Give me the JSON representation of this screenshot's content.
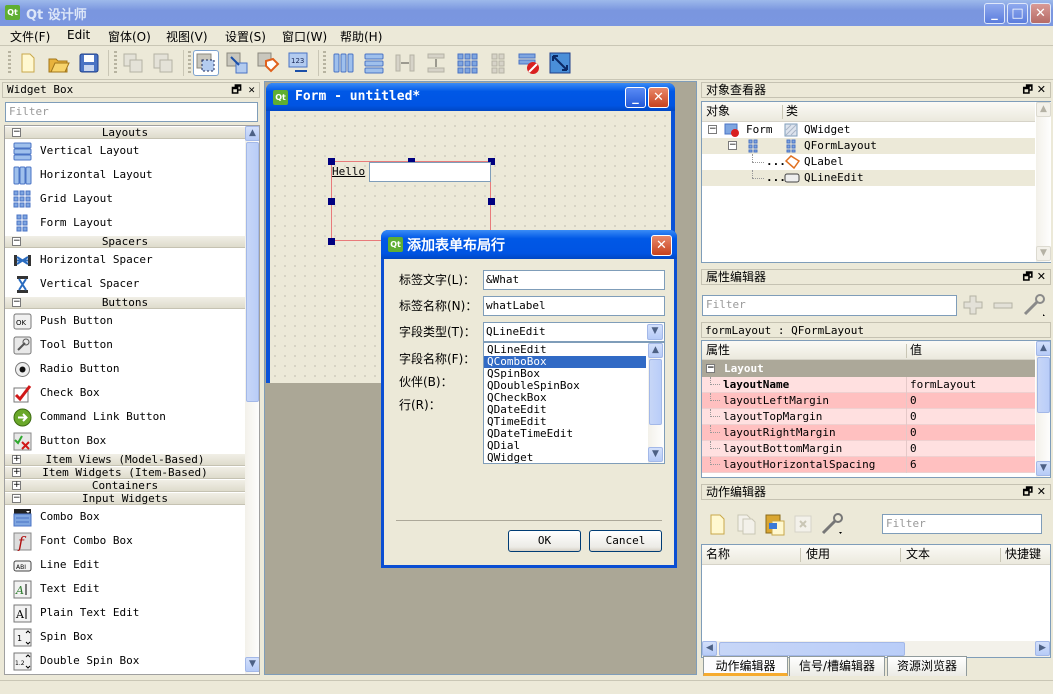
{
  "app": {
    "title": "Qt 设计师",
    "window_buttons": {
      "minimize": "_",
      "maximize": "□",
      "close": "✕"
    }
  },
  "menubar": [
    {
      "label": "文件(F)"
    },
    {
      "label": "Edit"
    },
    {
      "label": "窗体(O)"
    },
    {
      "label": "视图(V)"
    },
    {
      "label": "设置(S)"
    },
    {
      "label": "窗口(W)"
    },
    {
      "label": "帮助(H)"
    }
  ],
  "toolbar": {
    "icons": [
      "new-file-icon",
      "open-folder-icon",
      "save-icon",
      "copy-disabled-icon",
      "paste-disabled-icon",
      "edit-widgets-icon",
      "edit-signals-slots-icon",
      "edit-buddies-icon",
      "edit-tab-order-icon",
      "horizontal-layout-icon",
      "vertical-layout-icon",
      "horizontal-splitter-icon",
      "vertical-splitter-icon",
      "grid-layout-icon",
      "form-layout-icon",
      "break-layout-icon",
      "adjust-size-icon"
    ],
    "active_index": 5
  },
  "widget_box": {
    "title": "Widget Box",
    "filter_placeholder": "Filter",
    "categories": [
      {
        "name": "Layouts",
        "expanded": true,
        "items": [
          {
            "label": "Vertical Layout",
            "icon": "vertical-layout-icon"
          },
          {
            "label": "Horizontal Layout",
            "icon": "horizontal-layout-icon"
          },
          {
            "label": "Grid Layout",
            "icon": "grid-layout-icon"
          },
          {
            "label": "Form Layout",
            "icon": "form-layout-icon"
          }
        ]
      },
      {
        "name": "Spacers",
        "expanded": true,
        "items": [
          {
            "label": "Horizontal Spacer",
            "icon": "horizontal-spacer-icon"
          },
          {
            "label": "Vertical Spacer",
            "icon": "vertical-spacer-icon"
          }
        ]
      },
      {
        "name": "Buttons",
        "expanded": true,
        "items": [
          {
            "label": "Push Button",
            "icon": "push-button-icon"
          },
          {
            "label": "Tool Button",
            "icon": "tool-button-icon"
          },
          {
            "label": "Radio Button",
            "icon": "radio-button-icon"
          },
          {
            "label": "Check Box",
            "icon": "check-box-icon"
          },
          {
            "label": "Command Link Button",
            "icon": "command-link-icon"
          },
          {
            "label": "Button Box",
            "icon": "button-box-icon"
          }
        ]
      },
      {
        "name": "Item Views (Model-Based)",
        "expanded": false,
        "items": []
      },
      {
        "name": "Item Widgets (Item-Based)",
        "expanded": false,
        "items": []
      },
      {
        "name": "Containers",
        "expanded": false,
        "items": []
      },
      {
        "name": "Input Widgets",
        "expanded": true,
        "items": [
          {
            "label": "Combo Box",
            "icon": "combo-box-icon"
          },
          {
            "label": "Font Combo Box",
            "icon": "font-combo-box-icon"
          },
          {
            "label": "Line Edit",
            "icon": "line-edit-icon"
          },
          {
            "label": "Text Edit",
            "icon": "text-edit-icon"
          },
          {
            "label": "Plain Text Edit",
            "icon": "plain-text-edit-icon"
          },
          {
            "label": "Spin Box",
            "icon": "spin-box-icon"
          },
          {
            "label": "Double Spin Box",
            "icon": "double-spin-box-icon"
          }
        ]
      }
    ]
  },
  "form_window": {
    "title": "Form - untitled*",
    "label_text": "Hello",
    "line_edit_value": ""
  },
  "dialog": {
    "title": "添加表单布局行",
    "fields": {
      "label_text": {
        "label": "标签文字(L)：",
        "value": "&What"
      },
      "label_name": {
        "label": "标签名称(N)：",
        "value": "whatLabel"
      },
      "field_type": {
        "label": "字段类型(T)：",
        "value": "QLineEdit"
      },
      "field_name": {
        "label": "字段名称(F)："
      },
      "buddy": {
        "label": "伙伴(B)："
      },
      "row": {
        "label": "行(R)："
      }
    },
    "dropdown_options": [
      "QLineEdit",
      "QComboBox",
      "QSpinBox",
      "QDoubleSpinBox",
      "QCheckBox",
      "QDateEdit",
      "QTimeEdit",
      "QDateTimeEdit",
      "QDial",
      "QWidget"
    ],
    "dropdown_highlighted": "QComboBox",
    "ok_label": "OK",
    "cancel_label": "Cancel"
  },
  "object_inspector": {
    "title": "对象查看器",
    "columns": [
      "对象",
      "类"
    ],
    "rows": [
      {
        "object": "Form",
        "class": "QWidget",
        "level": 0
      },
      {
        "object": "",
        "class": "QFormLayout",
        "level": 1
      },
      {
        "object": "...",
        "class": "QLabel",
        "level": 2
      },
      {
        "object": "...",
        "class": "QLineEdit",
        "level": 2
      }
    ]
  },
  "property_editor": {
    "title": "属性编辑器",
    "filter_placeholder": "Filter",
    "object_label": "formLayout : QFormLayout",
    "columns": [
      "属性",
      "值"
    ],
    "group": "Layout",
    "properties": [
      {
        "name": "layoutName",
        "value": "formLayout",
        "bold": true
      },
      {
        "name": "layoutLeftMargin",
        "value": "0"
      },
      {
        "name": "layoutTopMargin",
        "value": "0"
      },
      {
        "name": "layoutRightMargin",
        "value": "0"
      },
      {
        "name": "layoutBottomMargin",
        "value": "0"
      },
      {
        "name": "layoutHorizontalSpacing",
        "value": "6"
      }
    ]
  },
  "action_editor": {
    "title": "动作编辑器",
    "filter_placeholder": "Filter",
    "columns": [
      "名称",
      "使用",
      "文本",
      "快捷键"
    ],
    "tabs": [
      {
        "label": "动作编辑器",
        "active": true
      },
      {
        "label": "信号/槽编辑器",
        "active": false
      },
      {
        "label": "资源浏览器",
        "active": false
      }
    ]
  },
  "colors": {
    "xp_blue": "#0054e3",
    "selection": "#316ac5",
    "prop_row_light": "#ffe0e0",
    "prop_row_dark": "#ffc0c0",
    "mdi_background": "#aba796"
  }
}
